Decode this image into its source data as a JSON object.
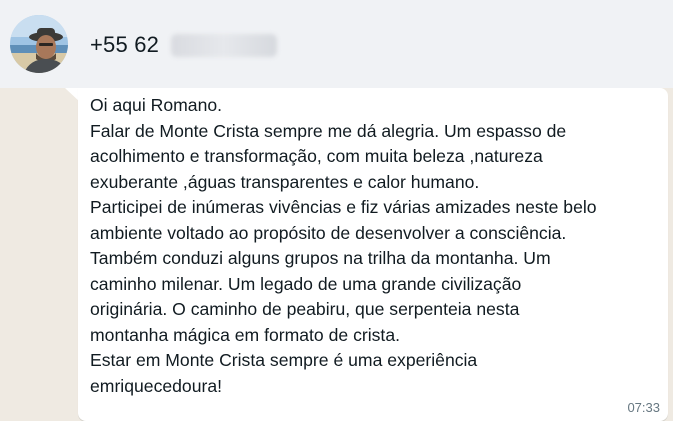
{
  "header": {
    "contact_prefix": "+55 62",
    "contact_redacted": "9651-8782",
    "avatar_icon": "profile-photo"
  },
  "message": {
    "lines": [
      "Oi aqui Romano.",
      "Falar de Monte Crista sempre me dá alegria. Um espasso de",
      "acolhimento e transformação, com muita beleza ,natureza",
      "exuberante ,águas transparentes e calor humano.",
      "Participei de inúmeras vivências e fiz várias amizades neste belo",
      "ambiente voltado ao propósito de desenvolver a consciência.",
      "Também conduzi alguns grupos na trilha da montanha. Um",
      "caminho milenar. Um legado de uma grande civilização",
      "originária. O caminho de peabiru, que serpenteia nesta",
      "montanha mágica em formato de crista.",
      "Estar em Monte Crista sempre é uma experiência",
      "emriquecedoura!"
    ],
    "time": "07:33"
  },
  "colors": {
    "header_bg": "#f0f2f5",
    "chat_bg": "#efeae2",
    "bubble_bg": "#ffffff",
    "text": "#111b21",
    "timestamp": "#667781"
  }
}
